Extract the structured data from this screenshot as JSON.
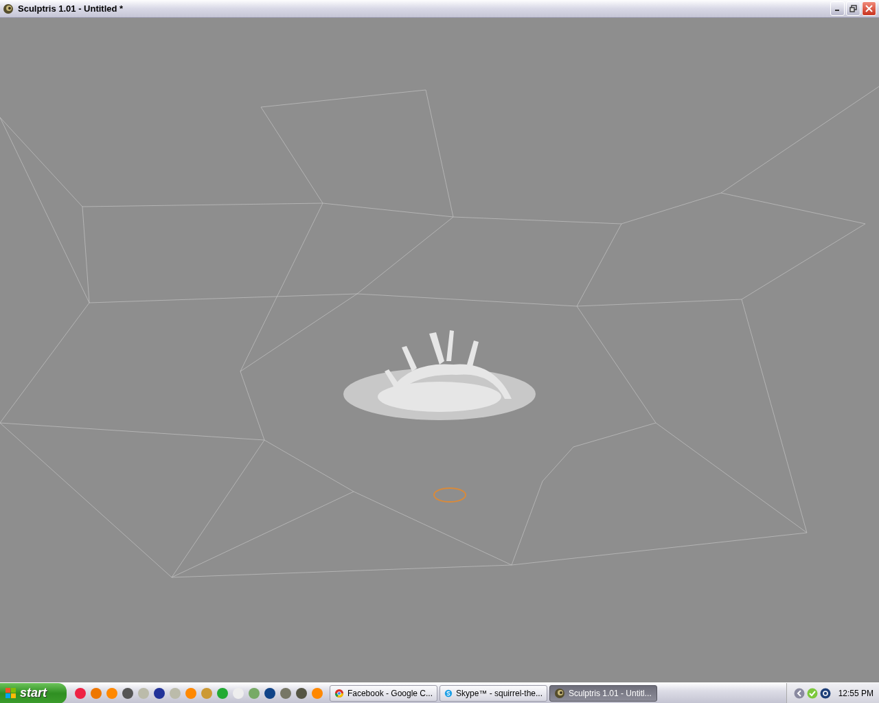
{
  "window": {
    "title": "Sculptris 1.01 - Untitled *"
  },
  "taskbar": {
    "start": "start",
    "tasks": [
      {
        "label": "Facebook - Google C...",
        "kind": "chrome",
        "selected": false
      },
      {
        "label": "Skype™ - squirrel-the...",
        "kind": "skype",
        "selected": false
      },
      {
        "label": "Sculptris 1.01 - Untitl...",
        "kind": "sculptris",
        "selected": true
      }
    ],
    "clock": "12:55 PM"
  }
}
